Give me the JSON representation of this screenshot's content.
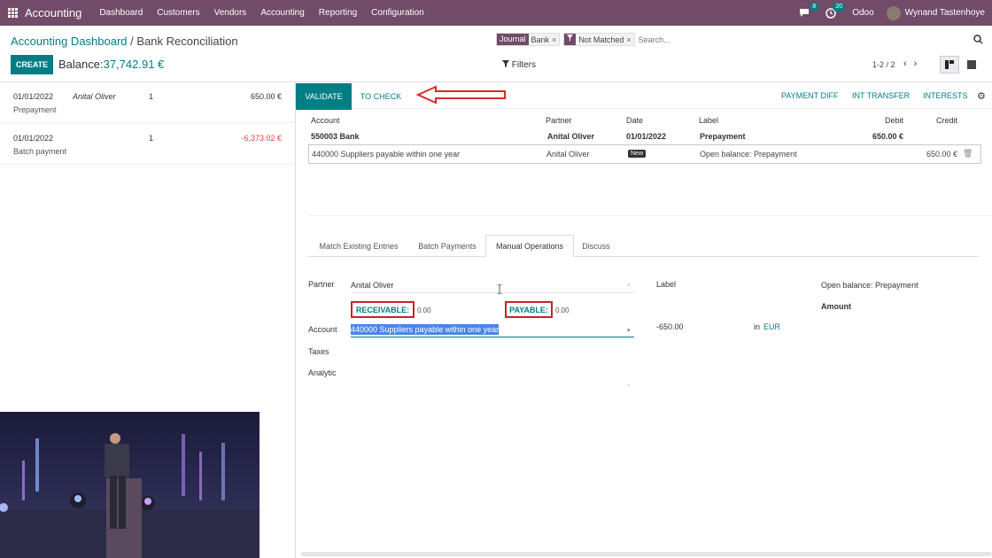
{
  "navbar": {
    "app_name": "Accounting",
    "menu": [
      "Dashboard",
      "Customers",
      "Vendors",
      "Accounting",
      "Reporting",
      "Configuration"
    ],
    "messages_count": "8",
    "activities_count": "20",
    "company": "Odoo",
    "user": "Wynand Tastenhoye"
  },
  "breadcrumb": {
    "parent": "Accounting Dashboard",
    "separator": "/",
    "current": "Bank Reconciliation"
  },
  "actions": {
    "create_label": "CREATE",
    "balance_label": "Balance:",
    "balance_value": "37,742.91 €"
  },
  "search": {
    "facets": [
      {
        "key": "Journal",
        "value": "Bank"
      },
      {
        "key": "filter-icon",
        "value": "Not Matched"
      }
    ],
    "placeholder": "Search..."
  },
  "toolbar": {
    "filters_label": "Filters",
    "pager": "1-2 / 2"
  },
  "statements": [
    {
      "date": "01/01/2022",
      "partner": "Anital Oliver",
      "count": "1",
      "amount": "650.00 €",
      "description": "Prepayment"
    },
    {
      "date": "01/01/2022",
      "partner": "",
      "count": "1",
      "amount": "-6,373.02 €",
      "description": "Batch payment"
    }
  ],
  "reconcile": {
    "validate_label": "VALIDATE",
    "to_check_label": "TO CHECK",
    "right_buttons": [
      "PAYMENT DIFF",
      "INT TRANSFER",
      "INTERESTS"
    ]
  },
  "grid": {
    "headers": [
      "Account",
      "Partner",
      "Date",
      "Label",
      "Debit",
      "Credit"
    ],
    "row1": {
      "account": "550003 Bank",
      "partner": "Anital Oliver",
      "date": "01/01/2022",
      "label": "Prepayment",
      "debit": "650.00 €"
    },
    "row2": {
      "account": "440000 Suppliers payable within one year",
      "partner": "Anital Oliver",
      "badge": "New",
      "label": "Open balance: Prepayment",
      "credit": "650.00 €"
    }
  },
  "tabs": [
    "Match Existing Entries",
    "Batch Payments",
    "Manual Operations",
    "Discuss"
  ],
  "form": {
    "partner_label": "Partner",
    "partner_value": "Anital Oliver",
    "receivable_label": "RECEIVABLE:",
    "receivable_value": "0.00",
    "payable_label": "PAYABLE:",
    "payable_value": "0.00",
    "account_label": "Account",
    "account_value": "440000 Suppliers payable within one year",
    "taxes_label": "Taxes",
    "analytic_label": "Analytic",
    "label_label": "Label",
    "label_value": "Open balance: Prepayment",
    "amount_label": "Amount",
    "amount_value": "-650.00",
    "currency_prefix": "in",
    "currency": "EUR"
  }
}
